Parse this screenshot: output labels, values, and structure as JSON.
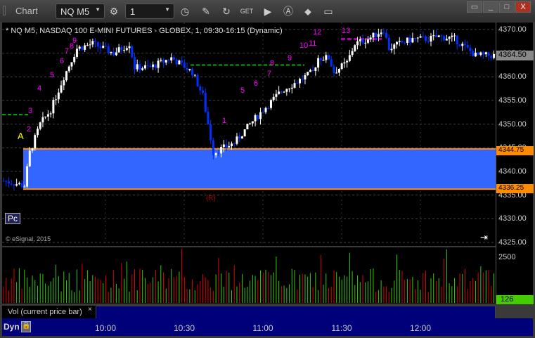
{
  "window": {
    "title": "Chart",
    "symbol": "NQ M5",
    "interval": "1"
  },
  "toolbar_icons": [
    "settings-icon",
    "clock-icon",
    "pencil-icon",
    "refresh-icon",
    "get-icon",
    "play-icon",
    "alert-icon",
    "link-icon",
    "comment-icon"
  ],
  "window_buttons": [
    "restore-icon",
    "minimize-icon",
    "maximize-icon",
    "close-icon"
  ],
  "chart": {
    "description": "* NQ M5, NASDAQ 100 E-MINI FUTURES - GLOBEX, 1, 09:30-16:15 (Dynamic)",
    "copyright": "© eSignal, 2015",
    "pc_label": "Pc",
    "a_label": "A",
    "r_label": "(R)",
    "price_ticks": [
      "4370.00",
      "4365.00",
      "4360.00",
      "4355.00",
      "4350.00",
      "4345.00",
      "4340.00",
      "4335.00",
      "4330.00",
      "4325.00"
    ],
    "tick_values": [
      4370,
      4365,
      4360,
      4355,
      4350,
      4345,
      4340,
      4335,
      4330,
      4325
    ],
    "last_price": "4364.50",
    "zone_high": "4344.75",
    "zone_low": "4336.25",
    "zone": [
      4336.25,
      4344.75
    ],
    "counts": [
      "1",
      "2",
      "3",
      "4",
      "5",
      "6",
      "7",
      "8",
      "9",
      "10",
      "11",
      "12",
      "13"
    ],
    "colors": {
      "up": "#ffffff",
      "down": "#0030ff",
      "zone": "#3366ff",
      "zone_line": "#ff8c00",
      "count": "#ff00ff",
      "vol_up": "#33cc00",
      "vol_down": "#dd0000"
    }
  },
  "chart_data": {
    "type": "candlestick",
    "x_minutes": [
      0,
      8,
      10,
      14,
      18,
      23,
      28,
      34,
      42,
      48,
      50,
      56,
      64,
      72,
      76,
      80,
      84,
      88,
      94,
      99,
      106,
      112,
      118,
      120,
      124,
      126,
      131,
      134,
      139,
      145,
      147,
      151,
      156,
      162,
      166,
      172,
      180,
      187,
      191,
      196,
      206,
      212,
      220
    ],
    "close": [
      4338,
      4337,
      4344,
      4350,
      4353,
      4360,
      4366,
      4367,
      4365,
      4367,
      4362,
      4362,
      4364,
      4361,
      4356,
      4344,
      4345,
      4346,
      4350,
      4353,
      4357,
      4359,
      4361,
      4364,
      4364,
      4361,
      4363,
      4367,
      4368,
      4370,
      4366,
      4367,
      4368,
      4368,
      4368.5,
      4368,
      4364.5,
      4364.5,
      4364.5,
      4364.5,
      4364.5,
      4364.5,
      4364.5
    ],
    "x_ticks": [
      "10:00",
      "10:30",
      "11:00",
      "11:30",
      "12:00"
    ],
    "ylim": [
      4325,
      4372
    ]
  },
  "volume": {
    "label": "Vol (current price bar)",
    "close_label": "×",
    "tick": "2500",
    "last": "126"
  },
  "time_axis": {
    "mode": "Dyn",
    "ticks": [
      "10:00",
      "10:30",
      "11:00",
      "11:30",
      "12:00"
    ]
  }
}
